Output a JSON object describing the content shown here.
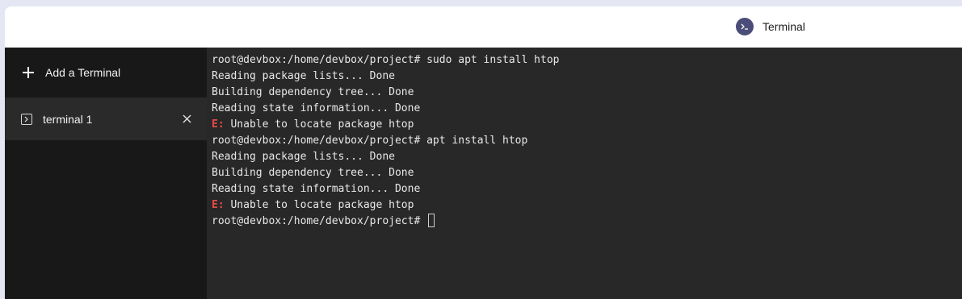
{
  "window": {
    "title": "Terminal",
    "icon": "terminal-app-icon"
  },
  "sidebar": {
    "add_label": "Add a Terminal",
    "tabs": [
      {
        "label": "terminal 1",
        "active": true
      }
    ]
  },
  "terminal": {
    "lines": [
      {
        "prefix": "",
        "text": "root@devbox:/home/devbox/project# sudo apt install htop"
      },
      {
        "prefix": "",
        "text": "Reading package lists... Done"
      },
      {
        "prefix": "",
        "text": "Building dependency tree... Done"
      },
      {
        "prefix": "",
        "text": "Reading state information... Done"
      },
      {
        "prefix": "E:",
        "text": " Unable to locate package htop"
      },
      {
        "prefix": "",
        "text": "root@devbox:/home/devbox/project# apt install htop"
      },
      {
        "prefix": "",
        "text": "Reading package lists... Done"
      },
      {
        "prefix": "",
        "text": "Building dependency tree... Done"
      },
      {
        "prefix": "",
        "text": "Reading state information... Done"
      },
      {
        "prefix": "E:",
        "text": " Unable to locate package htop"
      }
    ],
    "prompt": "root@devbox:/home/devbox/project#",
    "error_color": "#e64a4a",
    "background": "#282828"
  }
}
